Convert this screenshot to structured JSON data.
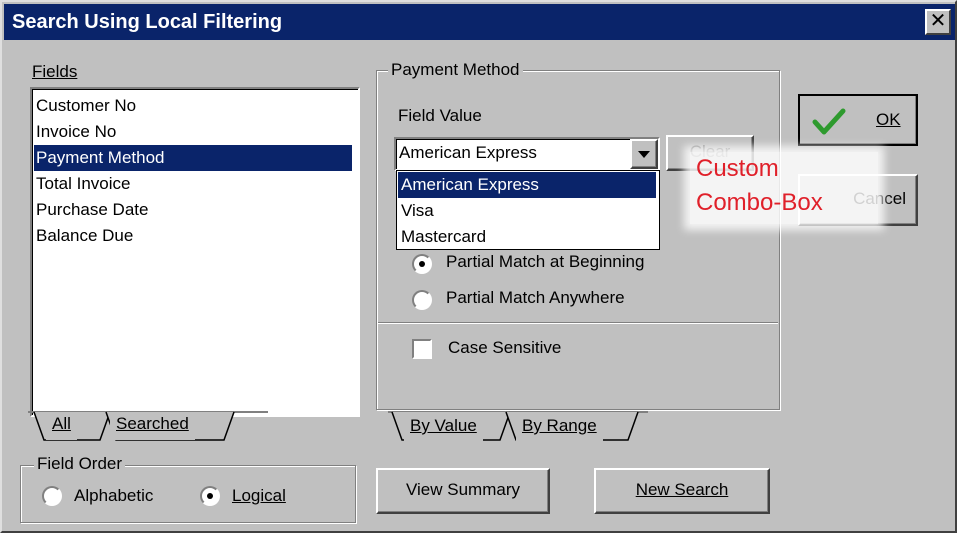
{
  "window": {
    "title": "Search Using Local Filtering",
    "close_glyph": "✕"
  },
  "fields": {
    "label": "Fields",
    "items": [
      "Customer No",
      "Invoice No",
      "Payment Method",
      "Total Invoice",
      "Purchase Date",
      "Balance Due"
    ],
    "selected": "Payment Method",
    "tabs": [
      "All",
      "Searched"
    ]
  },
  "field_order": {
    "label": "Field Order",
    "options": [
      "Alphabetic",
      "Logical"
    ],
    "selected": "Logical"
  },
  "payment_method": {
    "group_label": "Payment Method",
    "field_value_label": "Field Value",
    "combo_value": "American Express",
    "clear_label": "Clear",
    "dropdown_options": [
      "American Express",
      "Visa",
      "Mastercard"
    ],
    "dropdown_selected": "American Express",
    "match_options": [
      "Partial Match at Beginning",
      "Partial Match Anywhere"
    ],
    "match_selected": "Partial Match at Beginning",
    "case_sensitive_label": "Case Sensitive",
    "case_sensitive_checked": false,
    "tabs": [
      "By Value",
      "By Range"
    ]
  },
  "buttons": {
    "ok": "OK",
    "cancel": "Cancel",
    "view_summary": "View Summary",
    "new_search": "New Search"
  },
  "annotation": {
    "line1": "Custom",
    "line2": "Combo-Box"
  },
  "colors": {
    "title_bar": "#0a246a",
    "selection": "#0a246a",
    "face": "#c0c0c0",
    "annotation_text": "#e0202a",
    "ok_check": "#2e9a2e"
  },
  "icons": {
    "ok": "check-icon",
    "combo_arrow": "triangle-down-icon",
    "close": "close-icon"
  }
}
